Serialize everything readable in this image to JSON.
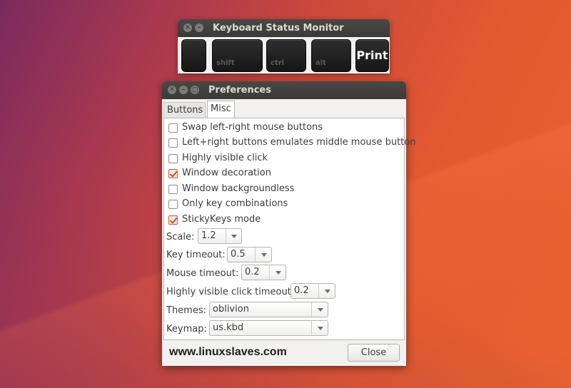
{
  "status_monitor": {
    "title": "Keyboard Status Monitor",
    "keys": [
      {
        "label": ""
      },
      {
        "label": "shift"
      },
      {
        "label": "ctrl"
      },
      {
        "label": "alt"
      },
      {
        "label": "Print"
      }
    ]
  },
  "preferences": {
    "title": "Preferences",
    "tabs": [
      {
        "label": "Buttons",
        "active": false
      },
      {
        "label": "Misc",
        "active": true
      }
    ],
    "options": [
      {
        "label": "Swap left-right mouse buttons",
        "checked": false
      },
      {
        "label": "Left+right buttons emulates middle mouse button",
        "checked": false
      },
      {
        "label": "Highly visible click",
        "checked": false
      },
      {
        "label": "Window decoration",
        "checked": true
      },
      {
        "label": "Window backgroundless",
        "checked": false
      },
      {
        "label": "Only key combinations",
        "checked": false
      },
      {
        "label": "StickyKeys mode",
        "checked": true
      }
    ],
    "fields": {
      "scale": {
        "label": "Scale:",
        "value": "1.2"
      },
      "key_timeout": {
        "label": "Key timeout:",
        "value": "0.5"
      },
      "mouse_timeout": {
        "label": "Mouse timeout:",
        "value": "0.2"
      },
      "click_timeout": {
        "label": "Highly visible click timeout:",
        "value": "0.2"
      },
      "themes": {
        "label": "Themes:",
        "value": "oblivion"
      },
      "keymap": {
        "label": "Keymap:",
        "value": "us.kbd"
      }
    },
    "watermark": "www.linuxslaves.com",
    "close_label": "Close"
  },
  "colors": {
    "accent_check": "#d4552a",
    "titlebar": "#3b3a37"
  }
}
